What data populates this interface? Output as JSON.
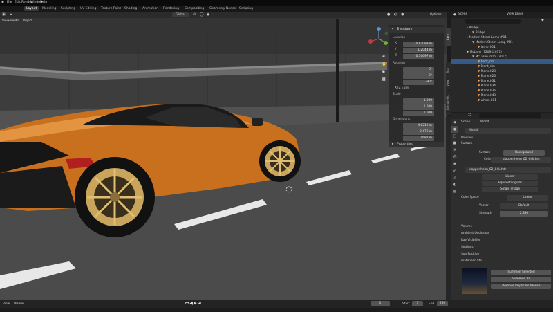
{
  "menu": {
    "file": "File",
    "edit": "Edit",
    "render": "Render",
    "window": "Window",
    "help": "Help"
  },
  "workspaces": [
    "Layout",
    "Modeling",
    "Sculpting",
    "UV Editing",
    "Texture Paint",
    "Shading",
    "Animation",
    "Rendering",
    "Compositing",
    "Geometry Nodes",
    "Scripting"
  ],
  "viewport": {
    "menus": {
      "view": "View",
      "select": "Select",
      "add": "Add",
      "object": "Object"
    },
    "orientation": "Global",
    "options": "Options"
  },
  "n_panel": {
    "transform_header": "Transform",
    "location_label": "Location",
    "location": {
      "x": "0.82098 m",
      "y": "1.2044 m",
      "z": "0.30697 m"
    },
    "rotation_label": "Rotation",
    "rotation": {
      "x": "0°",
      "y": "-0°",
      "z": "-90°"
    },
    "rotation_mode": "XYZ Euler",
    "scale_label": "Scale",
    "scale": {
      "x": "1.000",
      "y": "1.000",
      "z": "1.000"
    },
    "dimensions_label": "Dimensions",
    "dimensions": {
      "x": "4.0212 m",
      "y": "2.476 m",
      "z": "0.682 m"
    },
    "properties_header": "Properties",
    "axis": {
      "x": "X",
      "y": "Y",
      "z": "Z"
    },
    "tabs": [
      "Item",
      "Tool",
      "View",
      "BlenderKit"
    ]
  },
  "outliner": {
    "scene": "Scene",
    "view_layer": "View Layer",
    "rows": [
      "Bridge",
      "Bridge",
      "Modern Street Lamp #01",
      "Modern Street Lamp #01",
      "lamp_001",
      "McLaren 720S (2017)",
      "McLaren 720S (2017)",
      "back_rim",
      "Front_rim",
      "Plane.023",
      "Plane.026",
      "Plane.031",
      "Plane.034",
      "Plane.036",
      "Plane.043",
      "wheel.001"
    ]
  },
  "properties": {
    "scene_label": "Scene",
    "world_label": "World",
    "world_name": "World",
    "preview": "Preview",
    "surface": "Surface",
    "surface_label": "Surface",
    "surface_value": "Background",
    "color_label": "Color",
    "color_value": "kloppenheim_02_04k.hdr",
    "image_name": "kloppenheim_02_04k.hdr",
    "interp": "Linear",
    "projection": "Equirectangular",
    "source": "Single Image",
    "colorspace_label": "Color Space",
    "colorspace_value": "Linear",
    "vector_label": "Vector",
    "vector_value": "Default",
    "strength_label": "Strength",
    "strength_value": "2.330",
    "volume": "Volume",
    "ao": "Ambient Occlusion",
    "ray_visibility": "Ray Visibility",
    "settings": "Settings",
    "sun_position": "Sun Position",
    "addon": "materialiq lite",
    "btn_selected": "Summon Selected",
    "btn_all": "Summon All",
    "btn_remove": "Remove Duplicate Worlds",
    "side_tabs": [
      "Scene",
      "World",
      "Collection",
      "Object",
      "Modifiers",
      "Particles",
      "Physics",
      "Constraints",
      "Data",
      "Material",
      "Texture"
    ]
  },
  "timeline": {
    "view": "View",
    "marker": "Marker",
    "frame": "1",
    "start_label": "Start",
    "start": "1",
    "end_label": "End",
    "end": "250"
  },
  "colors": {
    "accent": "#355a85",
    "car": "#c8701e",
    "selected_tab": "#3b3b3b"
  }
}
